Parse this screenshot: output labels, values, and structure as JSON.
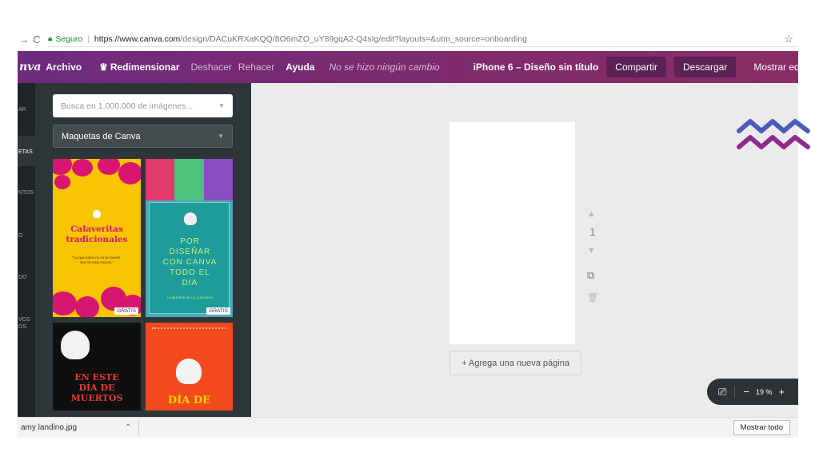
{
  "browser": {
    "back_icon": "back-arrow",
    "reload_icon": "reload",
    "secure_label": "Seguro",
    "url_host": "https://www.canva.com",
    "url_rest": "/design/DACuKRXaKQQ/8O6mZO_uY89gqA2-Q4sIg/edit?layouts=&utm_source=onboarding",
    "star_icon": "star"
  },
  "topbar": {
    "logo": "nva",
    "menu": {
      "archivo": "Archivo",
      "redimensionar": "Redimensionar",
      "deshacer": "Deshacer",
      "rehacer": "Rehacer",
      "ayuda": "Ayuda"
    },
    "status": "No se hizo ningún cambio",
    "design_title": "iPhone 6 – Diseño sin título",
    "share_label": "Compartir",
    "download_label": "Descargar",
    "team_label": "Mostrar equipo"
  },
  "rail": {
    "items": [
      "AR",
      "ETAS",
      "NTOS",
      "O",
      "DO",
      "VOS",
      "OS"
    ]
  },
  "panel": {
    "search_placeholder": "Busca en 1.000.000 de imágenes...",
    "category": "Maquetas de Canva",
    "templates": [
      {
        "title_line1": "Calaveritas",
        "title_line2": "tradicionales",
        "subtitle_line1": "\"Lo que todos no es la muerte,",
        "subtitle_line2": "sino la mala muerte.\"",
        "badge": "GRATIS"
      },
      {
        "title_line1": "POR",
        "title_line2": "DISEÑAR",
        "title_line3": "CON CANVA",
        "title_line4": "TODO EL",
        "title_line5": "DÍA",
        "subtitle": "LA MUERTE DE LO LLEVAREN",
        "badge": "GRATIS"
      },
      {
        "title_line1": "EN ESTE",
        "title_line2": "DÍA DE",
        "title_line3": "MUERTOS"
      },
      {
        "title": "DÍA DE"
      }
    ]
  },
  "canvas": {
    "page_number": "1",
    "add_page_label": "+ Agrega una nueva página",
    "zoom_level": "19 %"
  },
  "download_bar": {
    "file_name": "amy landino.jpg",
    "show_all_label": "Mostrar todo"
  },
  "colors": {
    "topbar": "#7a2a6f",
    "panel": "#2f363a",
    "workspace": "#ebebeb",
    "zigzag_blue": "#4c5bb8",
    "zigzag_purple": "#8e2a8e"
  }
}
